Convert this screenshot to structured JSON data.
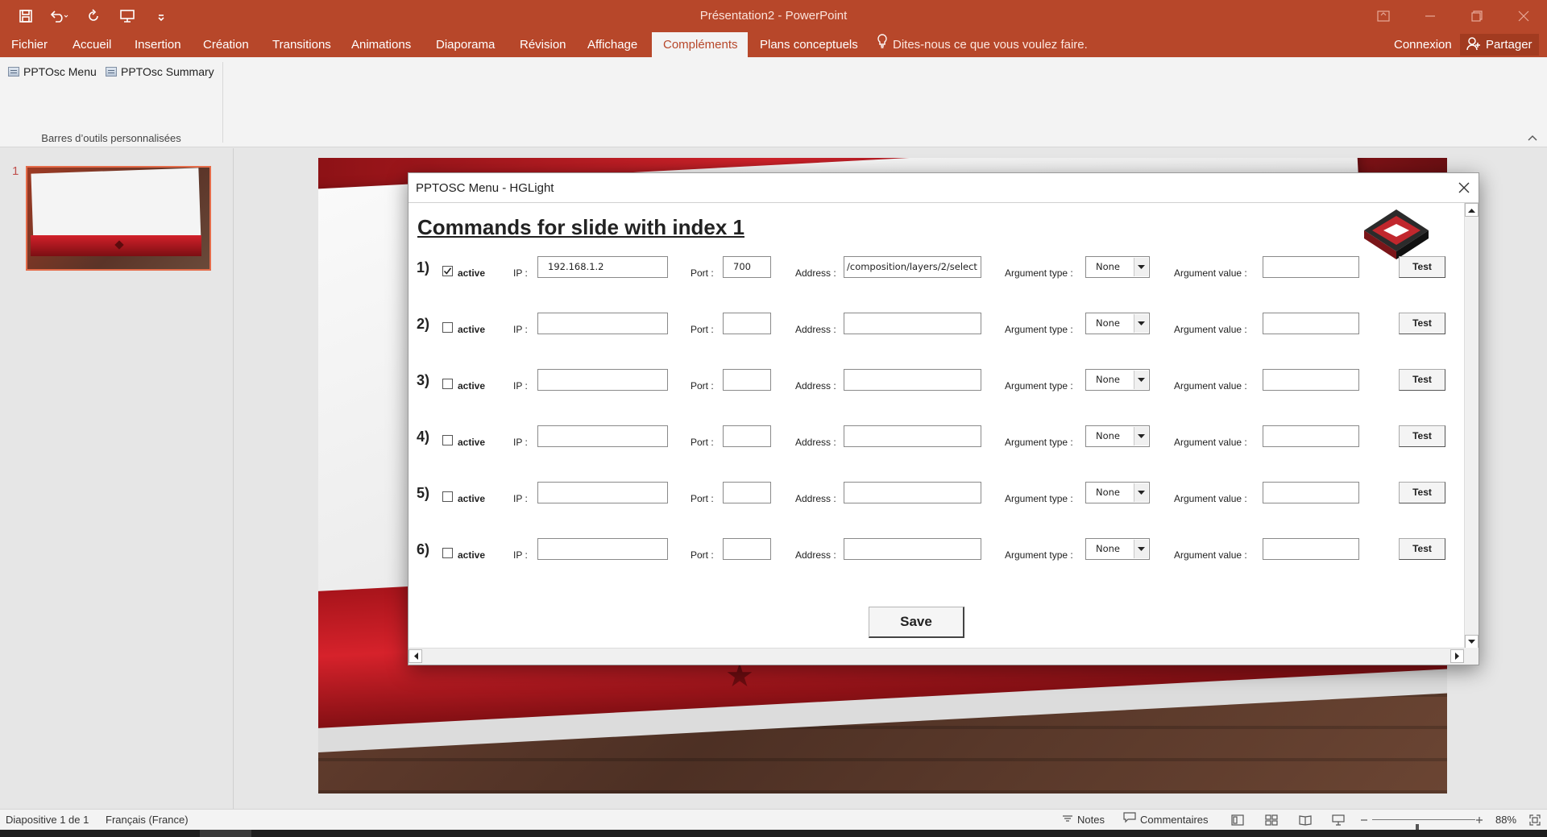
{
  "app": {
    "window_title": "Présentation2 - PowerPoint",
    "quick_access": {
      "save": "save-icon",
      "undo": "undo-icon",
      "redo": "redo-icon",
      "present": "present-icon",
      "customize": "customize-icon"
    }
  },
  "ribbon": {
    "tabs": [
      {
        "label": "Fichier",
        "active": false
      },
      {
        "label": "Accueil",
        "active": false
      },
      {
        "label": "Insertion",
        "active": false
      },
      {
        "label": "Création",
        "active": false
      },
      {
        "label": "Transitions",
        "active": false
      },
      {
        "label": "Animations",
        "active": false
      },
      {
        "label": "Diaporama",
        "active": false
      },
      {
        "label": "Révision",
        "active": false
      },
      {
        "label": "Affichage",
        "active": false
      },
      {
        "label": "Compléments",
        "active": true
      },
      {
        "label": "Plans conceptuels",
        "active": false
      }
    ],
    "tell_me": "Dites-nous ce que vous voulez faire.",
    "signin": "Connexion",
    "share": "Partager",
    "buttons": [
      {
        "label": "PPTOsc Menu"
      },
      {
        "label": "PPTOsc Summary"
      }
    ],
    "group_label": "Barres d’outils personnalisées"
  },
  "thumbnails": {
    "items": [
      {
        "number": "1"
      }
    ]
  },
  "dialog": {
    "title": "PPTOSC Menu - HGLight",
    "heading": "Commands for slide with index 1",
    "labels": {
      "active": "active",
      "ip": "IP :",
      "port": "Port :",
      "address": "Address :",
      "argument_type": "Argument type :",
      "argument_value": "Argument value :",
      "test": "Test"
    },
    "rows": [
      {
        "num": "1)",
        "checked": true,
        "ip": "192.168.1.2",
        "port": "700",
        "address": "/composition/layers/2/select",
        "argument_type": "None",
        "argument_value": ""
      },
      {
        "num": "2)",
        "checked": false,
        "ip": "",
        "port": "",
        "address": "",
        "argument_type": "None",
        "argument_value": ""
      },
      {
        "num": "3)",
        "checked": false,
        "ip": "",
        "port": "",
        "address": "",
        "argument_type": "None",
        "argument_value": ""
      },
      {
        "num": "4)",
        "checked": false,
        "ip": "",
        "port": "",
        "address": "",
        "argument_type": "None",
        "argument_value": ""
      },
      {
        "num": "5)",
        "checked": false,
        "ip": "",
        "port": "",
        "address": "",
        "argument_type": "None",
        "argument_value": ""
      },
      {
        "num": "6)",
        "checked": false,
        "ip": "",
        "port": "",
        "address": "",
        "argument_type": "None",
        "argument_value": ""
      }
    ],
    "save": "Save"
  },
  "statusbar": {
    "slide_info": "Diapositive 1 de 1",
    "language": "Français (France)",
    "notes": "Notes",
    "comments": "Commentaires",
    "zoom": "88%",
    "zoom_fraction": 0.44
  },
  "colors": {
    "accent": "#b7472a",
    "tab_active_text": "#b7472a"
  }
}
